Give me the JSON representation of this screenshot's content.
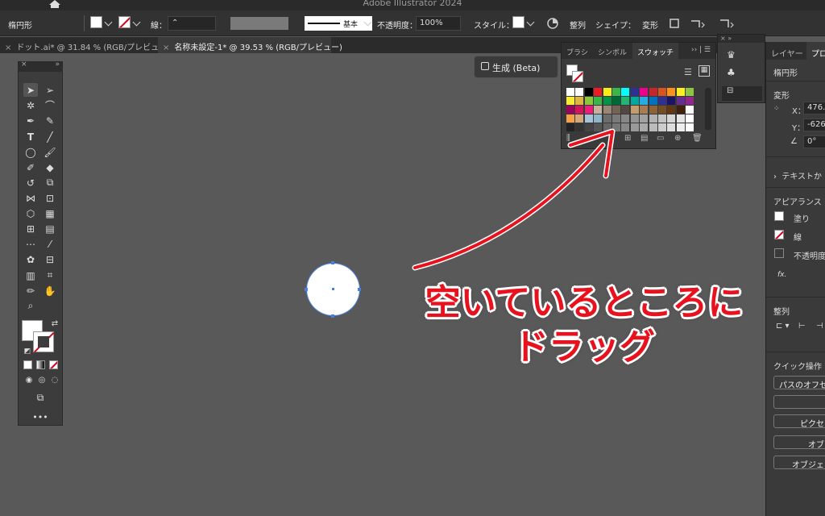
{
  "app": {
    "title": "Adobe Illustrator 2024"
  },
  "control_bar": {
    "object_type": "楕円形",
    "stroke_label": "線：",
    "stroke_profile": "基本",
    "opacity_label": "不透明度：",
    "opacity_value": "100%",
    "style_label": "スタイル：",
    "align_label": "整列",
    "shape_label": "シェイプ：",
    "transform_label": "変形"
  },
  "tabs": [
    {
      "label": "ドット.ai* @ 31.84 % (RGB/プレビュー)",
      "active": false
    },
    {
      "label": "名称未設定-1* @ 39.53 % (RGB/プレビュー)",
      "active": true
    }
  ],
  "generate_button": {
    "label": "生成 (Beta)"
  },
  "swatches_panel": {
    "tabs": [
      "ブラシ",
      "シンボル",
      "スウォッチ"
    ],
    "active_tab": "スウォッチ",
    "colors": [
      [
        "#ffffff",
        "#ffffff",
        "#000000",
        "#ed1c24",
        "#f7ec13",
        "#39b54a",
        "#00ffff",
        "#2e3192",
        "#ec008c",
        "#c1272d",
        "#d9531e",
        "#f7931e",
        "#fcee21",
        "#8cc63f"
      ],
      [
        "#f9ed32",
        "#ddb643",
        "#8dc63f",
        "#39b54a",
        "#009245",
        "#006837",
        "#22b573",
        "#00a99d",
        "#29abe2",
        "#0071bc",
        "#2e3192",
        "#1b1464",
        "#662d91",
        "#93278f"
      ],
      [
        "#9e005d",
        "#d4145a",
        "#ed1e79",
        "#c7b299",
        "#998675",
        "#736357",
        "#534741",
        "#c69c6d",
        "#a67c52",
        "#8c6239",
        "#754c24",
        "#603813",
        "#42210b",
        "#ffffff"
      ],
      [
        "#f7a04a",
        "#d3a87a",
        "#a6c3d8",
        "#8fb6c8",
        "#6d6d6d",
        "#7a7a7a",
        "#878787",
        "#949494",
        "#a1a1a1",
        "#b3b3b3",
        "#c4c4c4",
        "#d6d6d6",
        "#e6e6e6",
        "#ffffff"
      ],
      [
        "#222222",
        "#333333",
        "#444444",
        "#555555",
        "#666666",
        "#777777",
        "#888888",
        "#999999",
        "#aaaaaa",
        "#bbbbbb",
        "#cccccc",
        "#dddddd",
        "#eeeeee",
        "#ffffff"
      ]
    ]
  },
  "properties_panel": {
    "tabs": [
      "レイヤー",
      "プロ"
    ],
    "object_type": "楕円形",
    "transform_label": "変形",
    "x_label": "X：",
    "x_value": "476.",
    "y_label": "Y：",
    "y_value": "-626",
    "angle_value": "0°",
    "text_section": "テキストか",
    "appearance_label": "アピアランス",
    "fill_label": "塗り",
    "stroke_label": "線",
    "opacity_label": "不透明度",
    "fx_label": "fx.",
    "align_label": "整列",
    "quick_actions_label": "クイック操作",
    "quick_dropdown": "パスのオフセ",
    "buttons": [
      "ピクセ",
      "オブ",
      "オブジェ"
    ]
  },
  "annotation": {
    "line1": "空いているところに",
    "line2": "ドラッグ",
    "color": "#e8121f"
  }
}
